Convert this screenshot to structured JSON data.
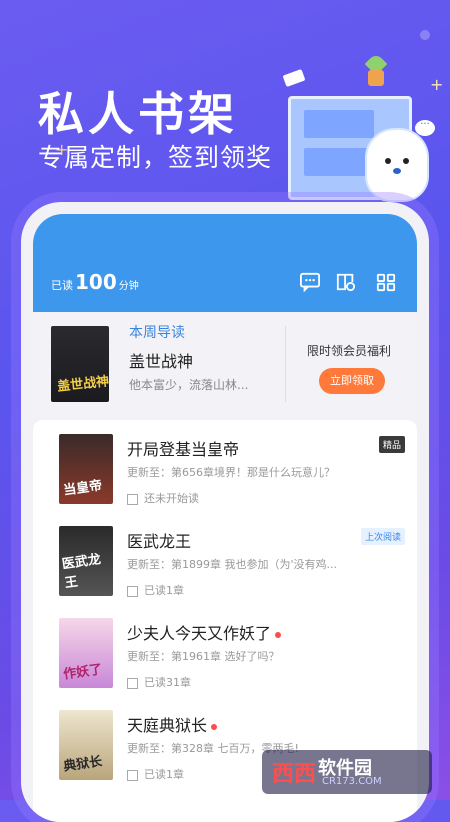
{
  "promo": {
    "title": "私人书架",
    "subtitle": "专属定制，签到领奖"
  },
  "header": {
    "read_label": "已读",
    "read_minutes": "100",
    "read_unit": "分钟"
  },
  "guide": {
    "tag": "本周导读",
    "name": "盖世战神",
    "desc": "他本富少，流落山林...",
    "cover_text": "盖世战神",
    "vip_title": "限时领会员福利",
    "vip_button": "立即领取"
  },
  "books": [
    {
      "title": "开局登基当皇帝",
      "update": "更新至：第656章境界！那是什么玩意儿？",
      "progress": "还未开始读",
      "badge": "精品",
      "cover_text": "当皇帝"
    },
    {
      "title": "医武龙王",
      "update": "更新至：第1899章 我也参加（为'没有鸡...",
      "progress": "已读1章",
      "badge": "上次阅读",
      "cover_text": "医武龙王"
    },
    {
      "title": "少夫人今天又作妖了",
      "update": "更新至：第1961章 选好了吗？",
      "progress": "已读31章",
      "badge": "",
      "cover_text": "作妖了"
    },
    {
      "title": "天庭典狱长",
      "update": "更新至：第328章 七百万，零两毛!",
      "progress": "已读1章",
      "badge": "",
      "cover_text": "典狱长"
    }
  ],
  "watermark": {
    "text1": "西西",
    "text2": "软件园",
    "text3": "CR173.COM"
  }
}
